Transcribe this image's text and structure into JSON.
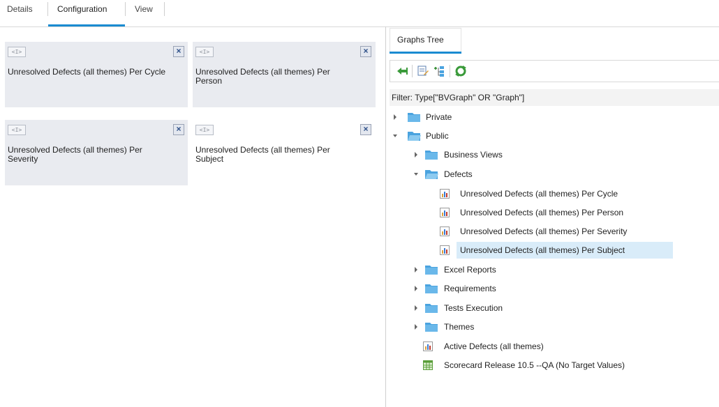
{
  "top_tabs": [
    {
      "label": "Details"
    },
    {
      "label": "Configuration"
    },
    {
      "label": "View"
    }
  ],
  "widgets": [
    {
      "icon_text": "<I>",
      "title": "Unresolved Defects (all themes) Per Cycle",
      "close": "×"
    },
    {
      "icon_text": "<I>",
      "title": "Unresolved Defects (all themes) Per Person",
      "close": "×"
    },
    {
      "icon_text": "<I>",
      "title": "Unresolved Defects (all themes) Per Severity",
      "close": "×"
    },
    {
      "icon_text": "<I>",
      "title": "Unresolved Defects (all themes) Per Subject",
      "close": "×"
    }
  ],
  "right_panel": {
    "tab_label": "Graphs Tree",
    "filter_text": "Filter: Type[\"BVGraph\" OR \"Graph\"]",
    "toolbar": [
      "back-arrow-icon",
      "edit-icon",
      "tree-add-icon",
      "refresh-icon"
    ],
    "tree": [
      {
        "label": "Private",
        "icon": "folder",
        "state": "collapsed"
      },
      {
        "label": "Public",
        "icon": "folder-open",
        "state": "expanded"
      },
      {
        "label": "Business Views",
        "icon": "folder",
        "state": "collapsed"
      },
      {
        "label": "Defects",
        "icon": "folder-open",
        "state": "expanded"
      },
      {
        "label": "Unresolved Defects (all themes) Per Cycle",
        "icon": "bar-chart"
      },
      {
        "label": "Unresolved Defects (all themes) Per Person",
        "icon": "bar-chart"
      },
      {
        "label": "Unresolved Defects (all themes) Per Severity",
        "icon": "bar-chart"
      },
      {
        "label": "Unresolved Defects (all themes) Per Subject",
        "icon": "bar-chart",
        "selected": true
      },
      {
        "label": "Excel Reports",
        "icon": "folder",
        "state": "collapsed"
      },
      {
        "label": "Requirements",
        "icon": "folder",
        "state": "collapsed"
      },
      {
        "label": "Tests Execution",
        "icon": "folder",
        "state": "collapsed"
      },
      {
        "label": "Themes",
        "icon": "folder",
        "state": "collapsed"
      },
      {
        "label": "Active Defects (all themes)",
        "icon": "bar-chart"
      },
      {
        "label": "Scorecard Release 10.5 --QA (No Target Values)",
        "icon": "scorecard-grid"
      }
    ]
  },
  "colors": {
    "accent": "#1a8bd1",
    "card_bg": "#e9ebf0",
    "selected_bg": "#d9ecf9",
    "folder": "#4aa3df"
  }
}
